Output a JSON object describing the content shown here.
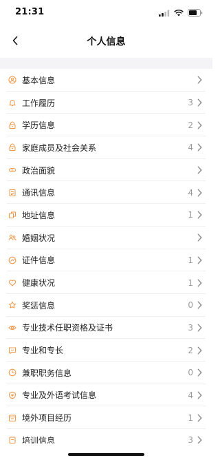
{
  "status_bar": {
    "time": "21:31",
    "icons": [
      "signal-icon",
      "wifi-icon",
      "battery-icon"
    ]
  },
  "nav": {
    "title": "个人信息",
    "back_icon": "chevron-left-icon"
  },
  "colors": {
    "accent": "#f0994a",
    "text": "#222222",
    "muted": "#999999",
    "background_gap": "#f4f4f6"
  },
  "items": [
    {
      "label": "基本信息",
      "count": "",
      "icon": "user-circle-icon"
    },
    {
      "label": "工作履历",
      "count": "3",
      "icon": "bell-icon"
    },
    {
      "label": "学历信息",
      "count": "2",
      "icon": "graduation-icon"
    },
    {
      "label": "家庭成员及社会关系",
      "count": "4",
      "icon": "family-icon"
    },
    {
      "label": "政治面貌",
      "count": "",
      "icon": "badge-icon"
    },
    {
      "label": "通讯信息",
      "count": "4",
      "icon": "contact-book-icon"
    },
    {
      "label": "地址信息",
      "count": "1",
      "icon": "address-icon"
    },
    {
      "label": "婚姻状况",
      "count": "",
      "icon": "couple-icon"
    },
    {
      "label": "证件信息",
      "count": "1",
      "icon": "id-card-icon"
    },
    {
      "label": "健康状况",
      "count": "1",
      "icon": "heart-icon"
    },
    {
      "label": "奖惩信息",
      "count": "0",
      "icon": "star-icon"
    },
    {
      "label": "专业技术任职资格及证书",
      "count": "3",
      "icon": "eye-icon"
    },
    {
      "label": "专业和专长",
      "count": "2",
      "icon": "chat-icon"
    },
    {
      "label": "兼职职务信息",
      "count": "0",
      "icon": "clock-icon"
    },
    {
      "label": "专业及外语考试信息",
      "count": "4",
      "icon": "shield-heart-icon"
    },
    {
      "label": "境外项目经历",
      "count": "1",
      "icon": "document-icon"
    },
    {
      "label": "培训信息",
      "count": "3",
      "icon": "training-icon"
    }
  ]
}
